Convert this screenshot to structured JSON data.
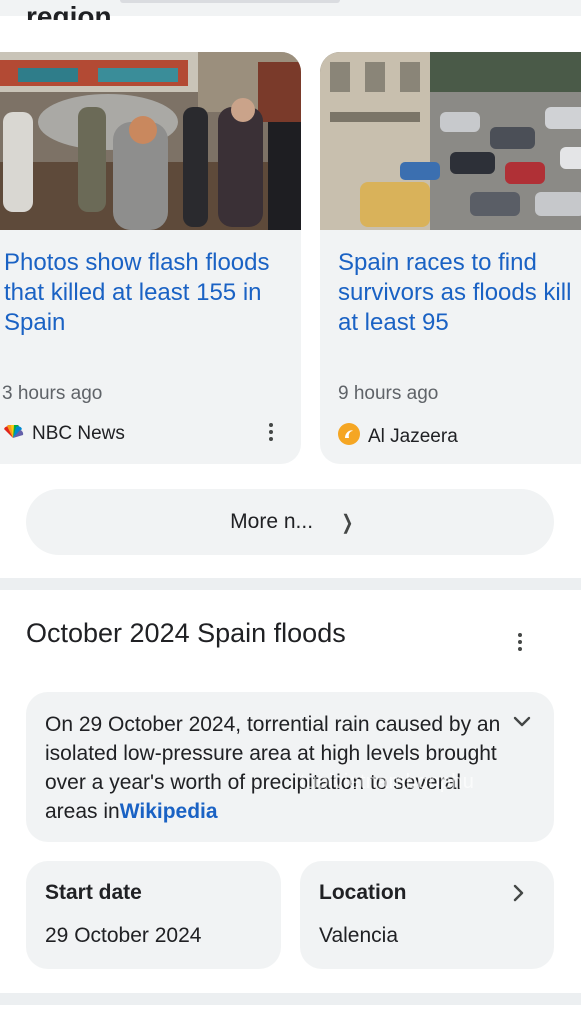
{
  "section": {
    "title": "region"
  },
  "news": [
    {
      "headline": "Photos show flash floods that killed at least 155 in Spain",
      "age": "3 hours ago",
      "source": "NBC News",
      "source_icon": "nbc-peacock-icon"
    },
    {
      "headline_lines": [
        "Spain races to find",
        "survivors as floods kill",
        "at least 95"
      ],
      "age": "9 hours ago",
      "source": "Al Jazeera",
      "source_icon": "al-jazeera-logo-icon"
    }
  ],
  "more_news": {
    "label": "More n..."
  },
  "knowledge_panel": {
    "title": "October 2024 Spain floods",
    "description": "On 29 October 2024, torrential rain caused by an isolated low-pressure area at high levels brought over a year's worth of precipitation to several areas in",
    "source_link": "Wikipedia",
    "facts": [
      {
        "label": "Start date",
        "value": "29 October 2024"
      },
      {
        "label": "Location",
        "value": "Valencia"
      }
    ]
  },
  "watermark": "tuoivietnambonphu",
  "colors": {
    "link": "#1a62c4",
    "card_bg": "#f1f3f4",
    "text": "#202124",
    "muted": "#5f6368"
  }
}
